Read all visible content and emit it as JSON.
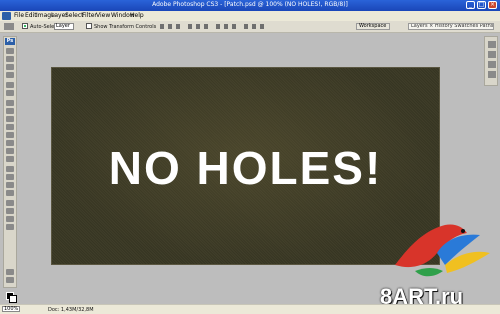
{
  "window": {
    "title": "Adobe Photoshop CS3 - [Patch.psd @ 100% (NO HOLES!, RGB/8)]"
  },
  "menu": [
    "File",
    "Edit",
    "Image",
    "Layer",
    "Select",
    "Filter",
    "View",
    "Window",
    "Help"
  ],
  "options": {
    "auto_select_label": "Auto-Select:",
    "auto_select_value": "Layer",
    "show_transform_label": "Show Transform Controls",
    "workspace_label": "Workspace",
    "layers_tab_text": "Layers × History Swatches Paths"
  },
  "canvas": {
    "headline": "NO HOLES!"
  },
  "status": {
    "zoom": "100%",
    "doc": "Doc: 1,43M/32,8M"
  },
  "watermark": {
    "text": "8ART.ru"
  },
  "colors": {
    "title_bar": "#1a46b8",
    "canvas_bg": "#3b3925",
    "workspace_bg": "#bdbdbd"
  },
  "icons": [
    "photoshop-logo-icon",
    "move-tool-icon",
    "marquee-tool-icon",
    "lasso-tool-icon",
    "crop-tool-icon",
    "brush-tool-icon",
    "eraser-tool-icon",
    "gradient-tool-icon",
    "type-tool-icon",
    "hand-tool-icon",
    "zoom-tool-icon",
    "parrot-logo-icon"
  ]
}
